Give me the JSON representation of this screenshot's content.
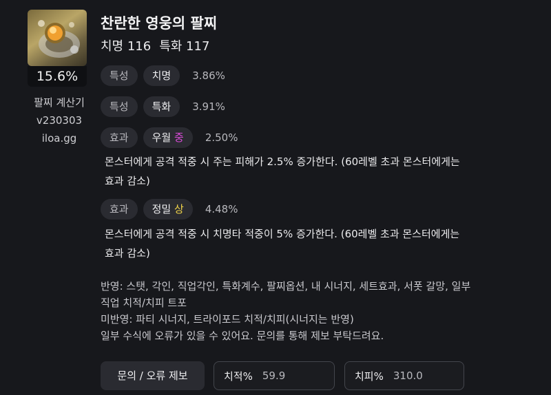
{
  "item": {
    "icon": "bracelet-icon",
    "percent": "15.6%"
  },
  "calculator": {
    "line1": "팔찌 계산기",
    "line2": "v230303",
    "line3": "iloa.gg"
  },
  "header": {
    "title": "찬란한 영웅의 팔찌",
    "stat1": "치명 116",
    "stat2": "특화 117"
  },
  "effects": [
    {
      "type": "특성",
      "name": "치명",
      "grade": "",
      "value": "3.86%",
      "description": ""
    },
    {
      "type": "특성",
      "name": "특화",
      "grade": "",
      "value": "3.91%",
      "description": ""
    },
    {
      "type": "효과",
      "name": "우월",
      "grade": "중",
      "value": "2.50%",
      "description_line1": "몬스터에게 공격 적중 시 주는 피해가 2.5% 증가한다. (60레벨 초과 몬스터에게는",
      "description_line2": "효과 감소)"
    },
    {
      "type": "효과",
      "name": "정밀",
      "grade": "상",
      "value": "4.48%",
      "description_line1": "몬스터에게 공격 적중 시 치명타 적중이 5% 증가한다. (60레벨 초과 몬스터에게는",
      "description_line2": "효과 감소)"
    }
  ],
  "notes": {
    "reflected_line1": "반영: 스탯, 각인, 직업각인, 특화계수, 팔찌옵션, 내 시너지, 세트효과, 서폿 갈망, 일부",
    "reflected_line2": "직업 치적/치피 트포",
    "not_reflected": "미반영: 파티 시너지, 트라이포드 치적/치피(시너지는 반영)",
    "disclaimer": "일부 수식에 오류가 있을 수 있어요. 문의를 통해 제보 부탁드려요."
  },
  "footer": {
    "report_button": "문의 / 오류 제보",
    "crit_rate_label": "치적%",
    "crit_rate_value": "59.9",
    "crit_dmg_label": "치피%",
    "crit_dmg_value": "310.0"
  },
  "colors": {
    "grade_mid": "#d94bd8",
    "grade_high": "#f2d54a",
    "background": "#17181c"
  }
}
